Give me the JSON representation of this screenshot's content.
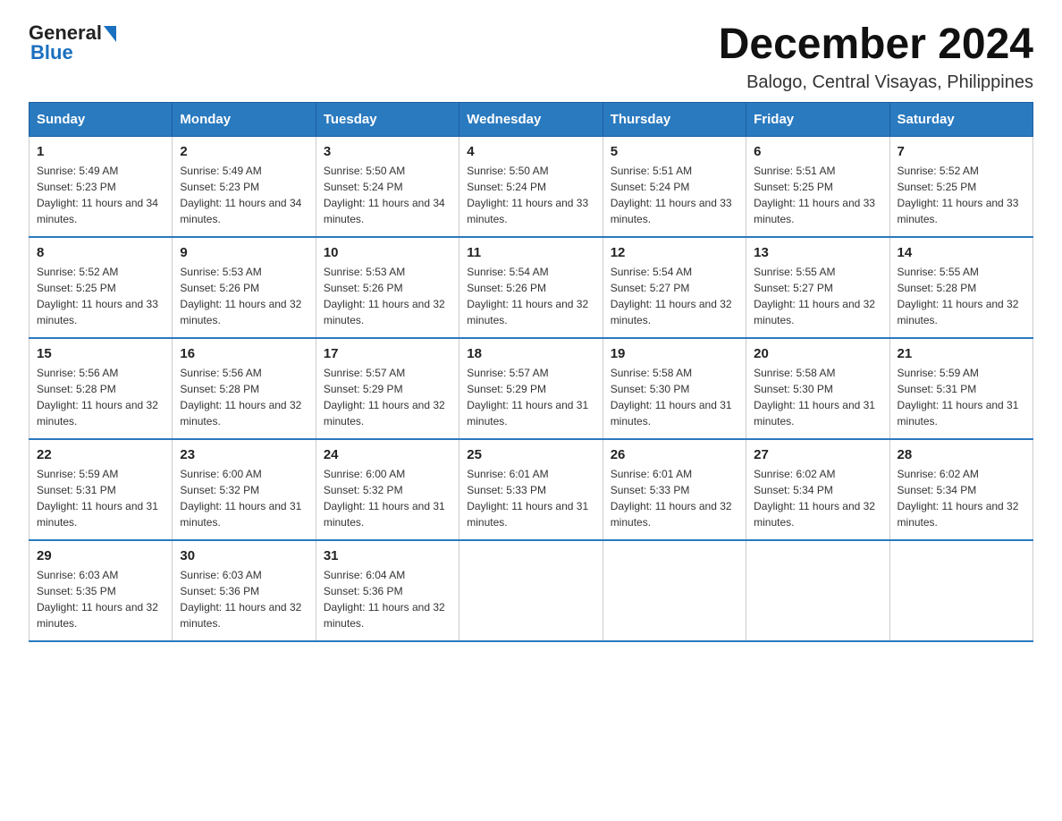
{
  "logo": {
    "text_general": "General",
    "text_blue": "Blue"
  },
  "title": "December 2024",
  "subtitle": "Balogo, Central Visayas, Philippines",
  "days_of_week": [
    "Sunday",
    "Monday",
    "Tuesday",
    "Wednesday",
    "Thursday",
    "Friday",
    "Saturday"
  ],
  "weeks": [
    [
      {
        "day": 1,
        "sunrise": "5:49 AM",
        "sunset": "5:23 PM",
        "daylight": "11 hours and 34 minutes"
      },
      {
        "day": 2,
        "sunrise": "5:49 AM",
        "sunset": "5:23 PM",
        "daylight": "11 hours and 34 minutes"
      },
      {
        "day": 3,
        "sunrise": "5:50 AM",
        "sunset": "5:24 PM",
        "daylight": "11 hours and 34 minutes"
      },
      {
        "day": 4,
        "sunrise": "5:50 AM",
        "sunset": "5:24 PM",
        "daylight": "11 hours and 33 minutes"
      },
      {
        "day": 5,
        "sunrise": "5:51 AM",
        "sunset": "5:24 PM",
        "daylight": "11 hours and 33 minutes"
      },
      {
        "day": 6,
        "sunrise": "5:51 AM",
        "sunset": "5:25 PM",
        "daylight": "11 hours and 33 minutes"
      },
      {
        "day": 7,
        "sunrise": "5:52 AM",
        "sunset": "5:25 PM",
        "daylight": "11 hours and 33 minutes"
      }
    ],
    [
      {
        "day": 8,
        "sunrise": "5:52 AM",
        "sunset": "5:25 PM",
        "daylight": "11 hours and 33 minutes"
      },
      {
        "day": 9,
        "sunrise": "5:53 AM",
        "sunset": "5:26 PM",
        "daylight": "11 hours and 32 minutes"
      },
      {
        "day": 10,
        "sunrise": "5:53 AM",
        "sunset": "5:26 PM",
        "daylight": "11 hours and 32 minutes"
      },
      {
        "day": 11,
        "sunrise": "5:54 AM",
        "sunset": "5:26 PM",
        "daylight": "11 hours and 32 minutes"
      },
      {
        "day": 12,
        "sunrise": "5:54 AM",
        "sunset": "5:27 PM",
        "daylight": "11 hours and 32 minutes"
      },
      {
        "day": 13,
        "sunrise": "5:55 AM",
        "sunset": "5:27 PM",
        "daylight": "11 hours and 32 minutes"
      },
      {
        "day": 14,
        "sunrise": "5:55 AM",
        "sunset": "5:28 PM",
        "daylight": "11 hours and 32 minutes"
      }
    ],
    [
      {
        "day": 15,
        "sunrise": "5:56 AM",
        "sunset": "5:28 PM",
        "daylight": "11 hours and 32 minutes"
      },
      {
        "day": 16,
        "sunrise": "5:56 AM",
        "sunset": "5:28 PM",
        "daylight": "11 hours and 32 minutes"
      },
      {
        "day": 17,
        "sunrise": "5:57 AM",
        "sunset": "5:29 PM",
        "daylight": "11 hours and 32 minutes"
      },
      {
        "day": 18,
        "sunrise": "5:57 AM",
        "sunset": "5:29 PM",
        "daylight": "11 hours and 31 minutes"
      },
      {
        "day": 19,
        "sunrise": "5:58 AM",
        "sunset": "5:30 PM",
        "daylight": "11 hours and 31 minutes"
      },
      {
        "day": 20,
        "sunrise": "5:58 AM",
        "sunset": "5:30 PM",
        "daylight": "11 hours and 31 minutes"
      },
      {
        "day": 21,
        "sunrise": "5:59 AM",
        "sunset": "5:31 PM",
        "daylight": "11 hours and 31 minutes"
      }
    ],
    [
      {
        "day": 22,
        "sunrise": "5:59 AM",
        "sunset": "5:31 PM",
        "daylight": "11 hours and 31 minutes"
      },
      {
        "day": 23,
        "sunrise": "6:00 AM",
        "sunset": "5:32 PM",
        "daylight": "11 hours and 31 minutes"
      },
      {
        "day": 24,
        "sunrise": "6:00 AM",
        "sunset": "5:32 PM",
        "daylight": "11 hours and 31 minutes"
      },
      {
        "day": 25,
        "sunrise": "6:01 AM",
        "sunset": "5:33 PM",
        "daylight": "11 hours and 31 minutes"
      },
      {
        "day": 26,
        "sunrise": "6:01 AM",
        "sunset": "5:33 PM",
        "daylight": "11 hours and 32 minutes"
      },
      {
        "day": 27,
        "sunrise": "6:02 AM",
        "sunset": "5:34 PM",
        "daylight": "11 hours and 32 minutes"
      },
      {
        "day": 28,
        "sunrise": "6:02 AM",
        "sunset": "5:34 PM",
        "daylight": "11 hours and 32 minutes"
      }
    ],
    [
      {
        "day": 29,
        "sunrise": "6:03 AM",
        "sunset": "5:35 PM",
        "daylight": "11 hours and 32 minutes"
      },
      {
        "day": 30,
        "sunrise": "6:03 AM",
        "sunset": "5:36 PM",
        "daylight": "11 hours and 32 minutes"
      },
      {
        "day": 31,
        "sunrise": "6:04 AM",
        "sunset": "5:36 PM",
        "daylight": "11 hours and 32 minutes"
      },
      null,
      null,
      null,
      null
    ]
  ]
}
